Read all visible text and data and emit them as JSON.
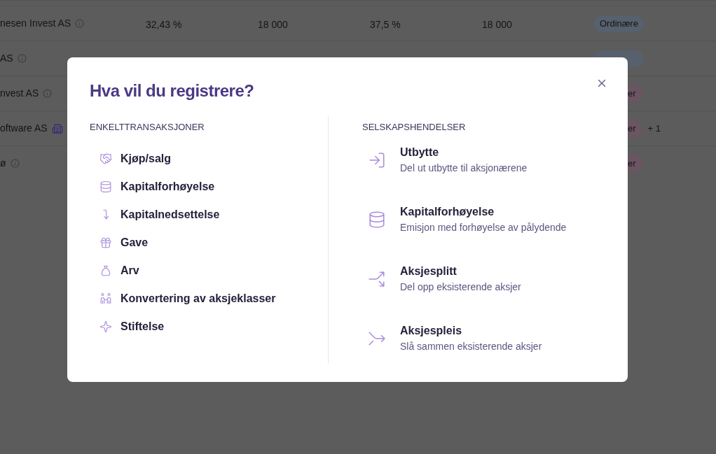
{
  "background_table": {
    "rows": [
      {
        "name": "nesen Invest AS",
        "cells": [
          "32,43 %",
          "18 000",
          "37,5 %",
          "18 000"
        ],
        "badge": {
          "label": "Ordinære",
          "color": "#57606d"
        }
      },
      {
        "name": "AS",
        "cells": [],
        "badge": {
          "color": "#57606d"
        }
      },
      {
        "name": "nvest AS",
        "cells": [],
        "badge": {
          "label": "er",
          "color": "#6b5562"
        }
      },
      {
        "name": "oftware AS",
        "cells": [],
        "badge": {
          "label": "er",
          "color": "#6b5562"
        },
        "extra": "+ 1"
      },
      {
        "name": "ø",
        "cells": [],
        "badge": {
          "label": "er",
          "color": "#6b5562"
        }
      }
    ]
  },
  "dialog": {
    "title": "Hva vil du registrere?",
    "left": {
      "heading": "ENKELTTRANSAKSJONER",
      "items": [
        {
          "label": "Kjøp/salg"
        },
        {
          "label": "Kapitalforhøyelse"
        },
        {
          "label": "Kapitalnedsettelse"
        },
        {
          "label": "Gave"
        },
        {
          "label": "Arv"
        },
        {
          "label": "Konvertering av aksjeklasser"
        },
        {
          "label": "Stiftelse"
        }
      ]
    },
    "right": {
      "heading": "SELSKAPSHENDELSER",
      "items": [
        {
          "title": "Utbytte",
          "description": "Del ut utbytte til aksjonærene"
        },
        {
          "title": "Kapitalforhøyelse",
          "description": "Emisjon med forhøyelse av pålydende"
        },
        {
          "title": "Aksjesplitt",
          "description": "Del opp eksisterende aksjer"
        },
        {
          "title": "Aksjespleis",
          "description": "Slå sammen eksisterende aksjer"
        }
      ]
    }
  }
}
